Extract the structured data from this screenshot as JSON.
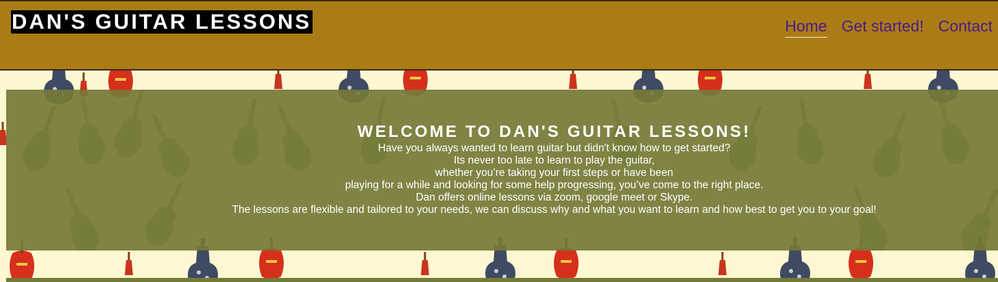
{
  "header": {
    "brand": "DAN'S GUITAR LESSONS",
    "nav": [
      {
        "label": "Home",
        "active": true
      },
      {
        "label": "Get started!",
        "active": false
      },
      {
        "label": "Contact",
        "active": false
      }
    ]
  },
  "welcome": {
    "title": "WELCOME TO DAN'S GUITAR LESSONS!",
    "lines": [
      "Have you always wanted to learn guitar but didn't know how to get started?",
      "Its never too late to learn to play the guitar,",
      "whether you’re taking your first steps or have been",
      "playing for a while and looking for some help progressing, you’ve come to the right place.",
      "Dan offers online lessons via zoom, google meet or Skype.",
      "The lessons are flexible and tailored to your needs, we can discuss why and what you want to learn and how best to get you to your goal!"
    ]
  },
  "colors": {
    "header_bg": "#ab7c16",
    "nav_link": "#4d1b86",
    "welcome_bg": "#767a38",
    "page_bg": "#fdf8d2"
  },
  "background_icons": [
    "electric-guitar-icon",
    "acoustic-guitar-icon"
  ]
}
